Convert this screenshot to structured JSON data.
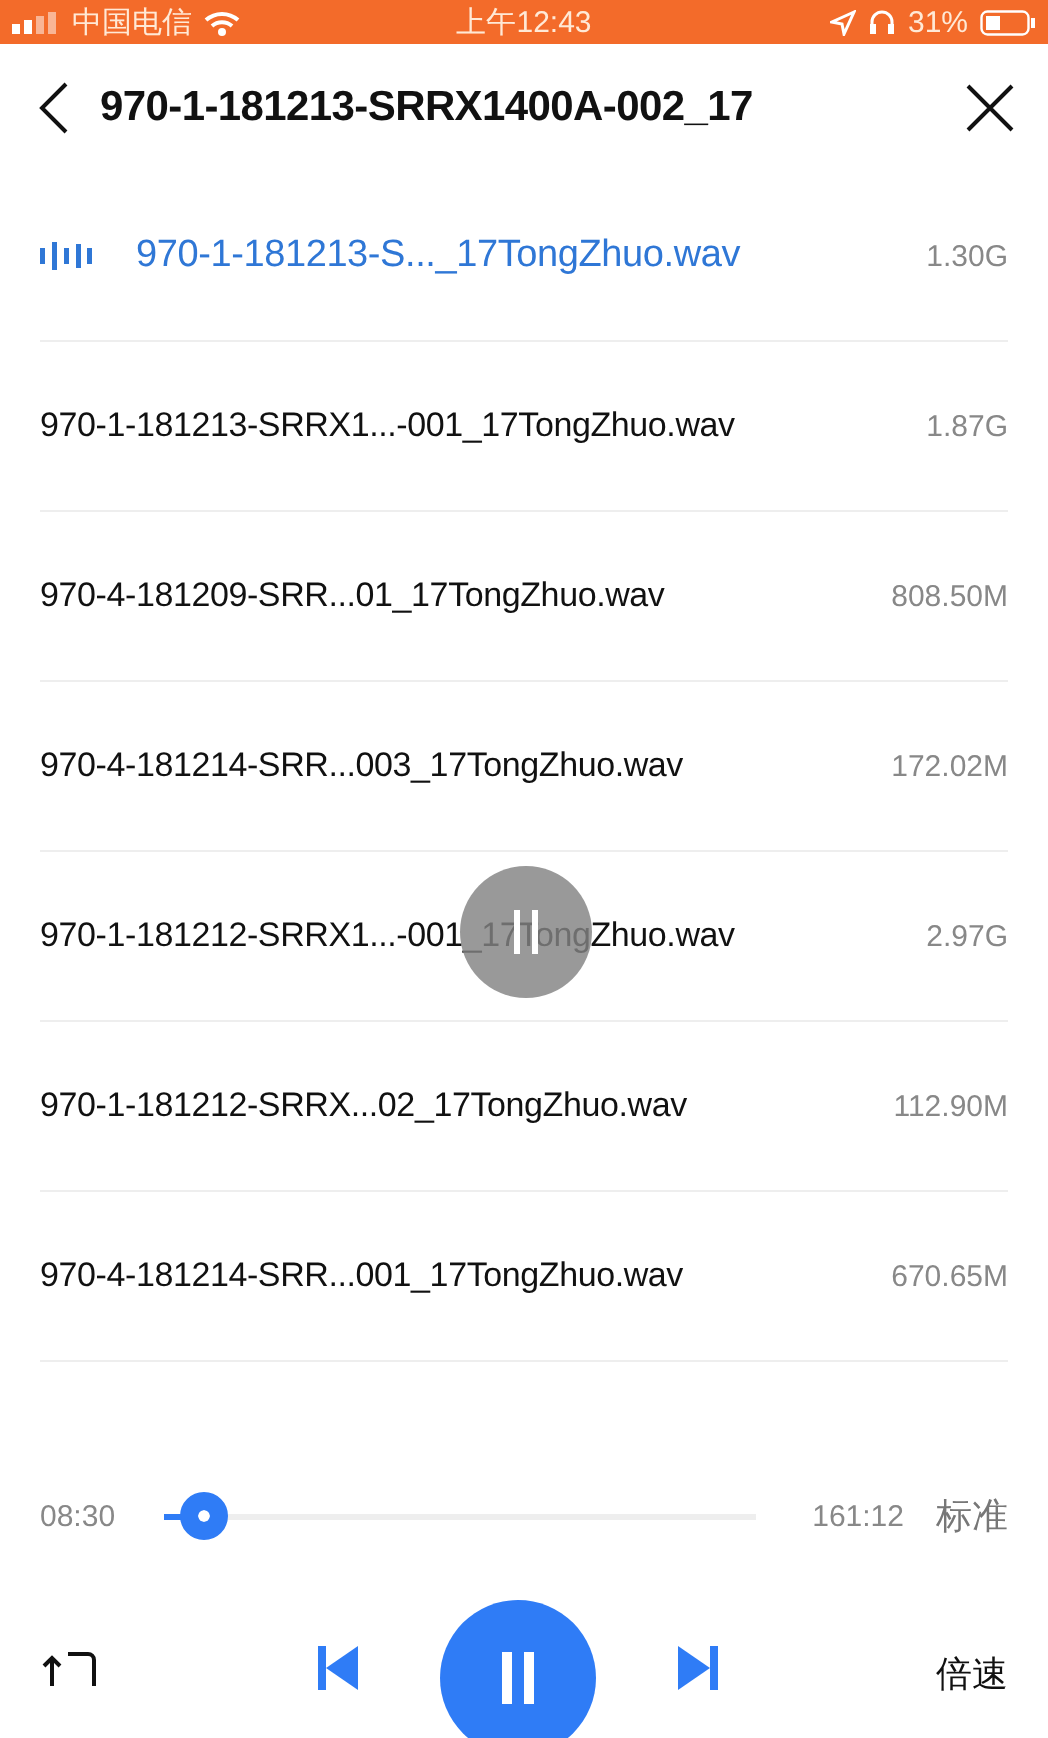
{
  "status_bar": {
    "carrier": "中国电信",
    "time": "上午12:43",
    "battery": "31%"
  },
  "header": {
    "title": "970-1-181213-SRRX1400A-002_17"
  },
  "files": [
    {
      "name": "970-1-181213-S..._17TongZhuo.wav",
      "size": "1.30G",
      "selected": true
    },
    {
      "name": "970-1-181213-SRRX1...-001_17TongZhuo.wav",
      "size": "1.87G",
      "selected": false
    },
    {
      "name": "970-4-181209-SRR...01_17TongZhuo.wav",
      "size": "808.50M",
      "selected": false
    },
    {
      "name": "970-4-181214-SRR...003_17TongZhuo.wav",
      "size": "172.02M",
      "selected": false
    },
    {
      "name": "970-1-181212-SRRX1...-001_17TongZhuo.wav",
      "size": "2.97G",
      "selected": false
    },
    {
      "name": "970-1-181212-SRRX...02_17TongZhuo.wav",
      "size": "112.90M",
      "selected": false
    },
    {
      "name": "970-4-181214-SRR...001_17TongZhuo.wav",
      "size": "670.65M",
      "selected": false
    }
  ],
  "player": {
    "elapsed": "08:30",
    "total": "161:12",
    "level": 0.07,
    "quality": "标准",
    "speed": "倍速",
    "playing": true
  }
}
